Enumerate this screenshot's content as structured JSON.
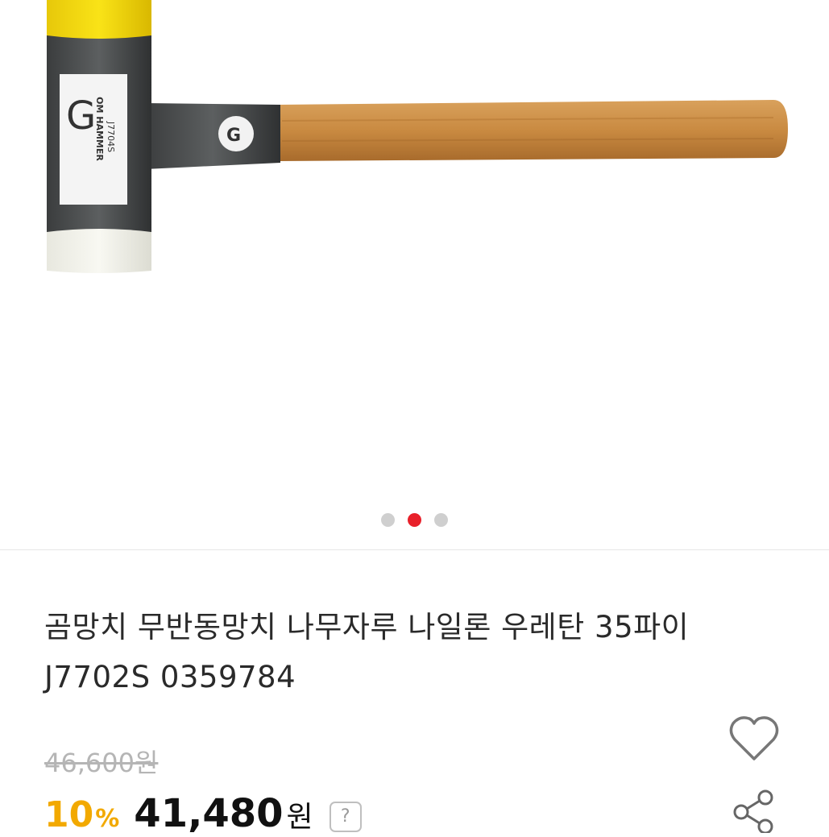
{
  "gallery": {
    "image_description_icon": "hammer-product-image",
    "brand_label": "OM HAMMER",
    "model_label": "J7704S",
    "dots": [
      {
        "active": false
      },
      {
        "active": true
      },
      {
        "active": false
      }
    ],
    "active_dot_color": "#e8202a"
  },
  "product": {
    "title": "곰망치 무반동망치 나무자루 나일론 우레탄 35파이 J7702S 0359784",
    "original_price": "46,600원",
    "discount_percent": "10",
    "discount_symbol": "%",
    "price": "41,480",
    "currency": "원",
    "help_label": "?"
  },
  "actions": {
    "wishlist_icon": "heart-outline-icon",
    "share_icon": "share-icon"
  },
  "colors": {
    "discount": "#f2a900",
    "text": "#222222",
    "muted": "#b5b5b5"
  }
}
